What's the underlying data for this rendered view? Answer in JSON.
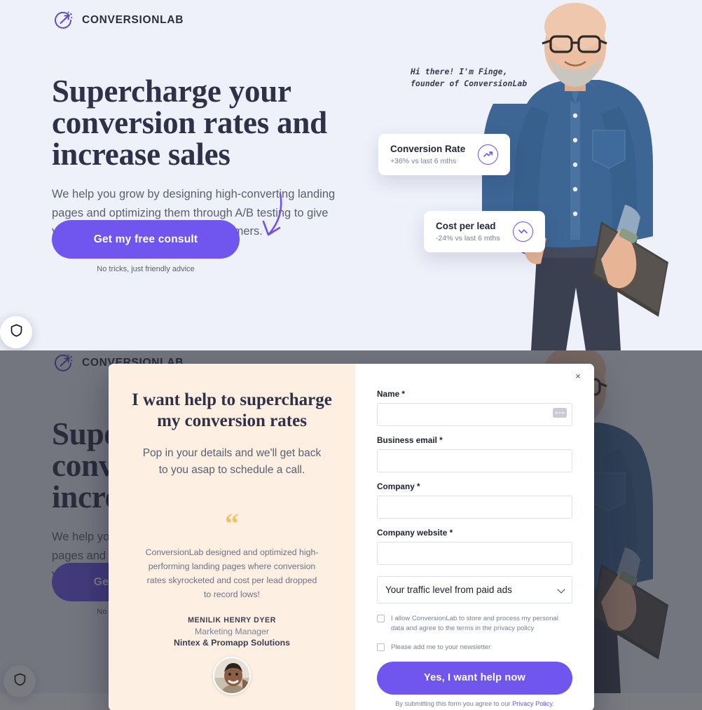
{
  "brand": {
    "name": "CONVERSIONLAB",
    "logo_icon": "conversionlab-logo-icon",
    "accent": "#7055ef"
  },
  "hero": {
    "heading": "Supercharge your conversion rates and increase sales",
    "subheading": "We help you grow by designing high-converting landing pages and optimizing them through A/B testing to give you more signups, leads, and customers.",
    "cta_label": "Get my free consult",
    "cta_note": "No tricks, just friendly advice",
    "handwriting": "Hi there! I'm Finge,\nfounder of ConversionLab",
    "arrow_icon": "curved-arrow-icon",
    "photo_alt": "founder-portrait",
    "stats": [
      {
        "title": "Conversion Rate",
        "delta": "+36% vs last 6 mths",
        "icon": "trend-up-icon"
      },
      {
        "title": "Cost per lead",
        "delta": "-24% vs last 6 mths",
        "icon": "trend-down-icon"
      }
    ]
  },
  "shield_badge": {
    "icon": "shield-icon"
  },
  "modal": {
    "close_label": "×",
    "heading": "I want help to supercharge my conversion rates",
    "paragraph": "Pop in your details and we'll get back to you asap to schedule a call.",
    "quote_mark": "“",
    "testimonial": {
      "text": "ConversionLab designed and optimized high-performing landing pages where conversion rates skyrocketed and cost per lead dropped to record lows!",
      "name": "MENILIK HENRY DYER",
      "role": "Marketing Manager",
      "org": "Nintex & Promapp Solutions",
      "avatar_alt": "testimonial-avatar"
    },
    "form": {
      "fields": [
        {
          "label": "Name *",
          "value": "",
          "placeholder": "",
          "name": "name-field"
        },
        {
          "label": "Business email *",
          "value": "",
          "placeholder": "",
          "name": "business-email-field"
        },
        {
          "label": "Company *",
          "value": "",
          "placeholder": "",
          "name": "company-field"
        },
        {
          "label": "Company website *",
          "value": "",
          "placeholder": "",
          "name": "company-website-field"
        }
      ],
      "select": {
        "selected": "Your traffic level from paid ads",
        "options": [
          "Your traffic level from paid ads"
        ]
      },
      "consent_checkbox": "I allow ConversionLab to store and process my personal data and agree to the terms in the privacy policy",
      "newsletter_checkbox": "Please add me to your newsletter",
      "submit_label": "Yes, I want help now",
      "submit_note_prefix": "By submitting this form you agree to our ",
      "submit_note_link": "Privacy Policy."
    }
  }
}
